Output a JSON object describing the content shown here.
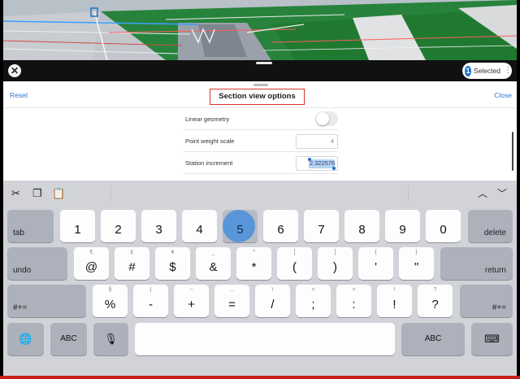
{
  "header": {
    "selected_count": "1",
    "selected_label": "Selected",
    "more_icon": "more-vertical-icon",
    "close_icon": "close-icon"
  },
  "panel": {
    "reset_label": "Reset",
    "title": "Section view options",
    "close_label": "Close",
    "rows": [
      {
        "label": "Linear geometry",
        "type": "toggle",
        "value": false
      },
      {
        "label": "Point weight scale",
        "type": "number",
        "value": "4"
      },
      {
        "label": "Station increment",
        "type": "number",
        "value": "2.322576"
      }
    ]
  },
  "shortcut_bar": {
    "icons": [
      "scissors-icon",
      "copy-icon",
      "paste-icon",
      "chevron-up-icon",
      "chevron-down-icon"
    ]
  },
  "keyboard": {
    "row1": [
      "1",
      "2",
      "3",
      "4",
      "5",
      "6",
      "7",
      "8",
      "9",
      "0"
    ],
    "tab_label": "tab",
    "delete_label": "delete",
    "row2": [
      {
        "alt": "€",
        "main": "@"
      },
      {
        "alt": "£",
        "main": "#"
      },
      {
        "alt": "¥",
        "main": "$"
      },
      {
        "alt": "_",
        "main": "&"
      },
      {
        "alt": "^",
        "main": "*"
      },
      {
        "alt": "[",
        "main": "("
      },
      {
        "alt": "]",
        "main": ")"
      },
      {
        "alt": "{",
        "main": "'"
      },
      {
        "alt": "}",
        "main": "\""
      }
    ],
    "undo_label": "undo",
    "return_label": "return",
    "row3": [
      {
        "alt": "§",
        "main": "%"
      },
      {
        "alt": "|",
        "main": "-"
      },
      {
        "alt": "~",
        "main": "+"
      },
      {
        "alt": "…",
        "main": "="
      },
      {
        "alt": "\\",
        "main": "/"
      },
      {
        "alt": "<",
        "main": ";"
      },
      {
        "alt": ">",
        "main": ":"
      },
      {
        "alt": "!",
        "main": "!"
      },
      {
        "alt": "?",
        "main": "?"
      }
    ],
    "shift_label": "#+=",
    "abc_label": "ABC",
    "globe_icon": "globe-icon",
    "mic_icon": "microphone-icon",
    "hide_icon": "keyboard-hide-icon",
    "pressed_key": "5"
  },
  "colors": {
    "accent": "#2a7ad6",
    "title_highlight": "#d8342b",
    "pressed_key": "#4f92db"
  }
}
